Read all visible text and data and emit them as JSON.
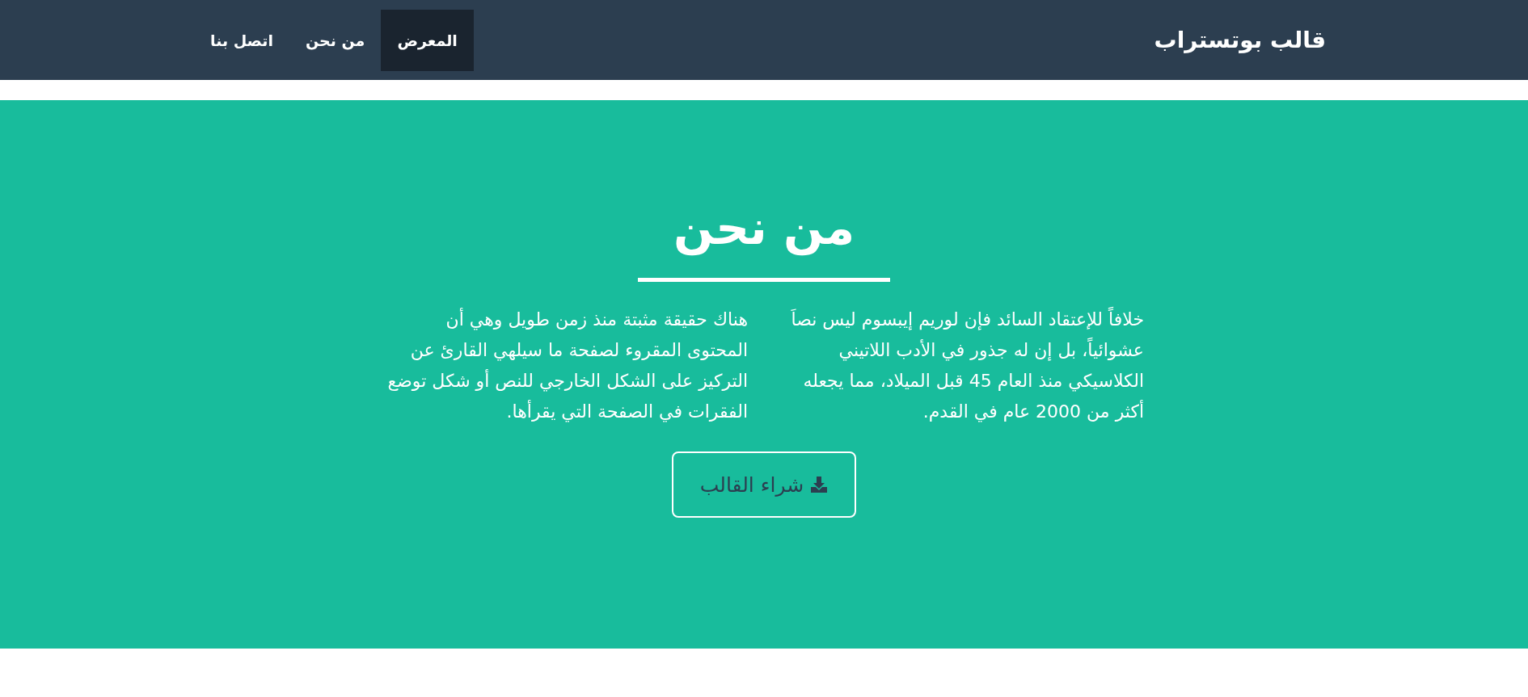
{
  "navbar": {
    "brand": "قالب بوتستراب",
    "items": [
      {
        "label": "المعرض",
        "selected": true
      },
      {
        "label": "من نحن",
        "selected": false
      },
      {
        "label": "اتصل بنا",
        "selected": false
      }
    ]
  },
  "section": {
    "title": "من نحن",
    "paragraphs": [
      "خلافاً للإعتقاد السائد فإن لوريم إيبسوم ليس نصاَ عشوائياً، بل إن له جذور في الأدب اللاتيني الكلاسيكي منذ العام 45 قبل الميلاد، مما يجعله أكثر من 2000 عام في القدم.",
      "هناك حقيقة مثبتة منذ زمن طويل وهي أن المحتوى المقروء لصفحة ما سيلهي القارئ عن التركيز على الشكل الخارجي للنص أو شكل توضع الفقرات في الصفحة التي يقرأها."
    ],
    "button": "شراء القالب"
  }
}
